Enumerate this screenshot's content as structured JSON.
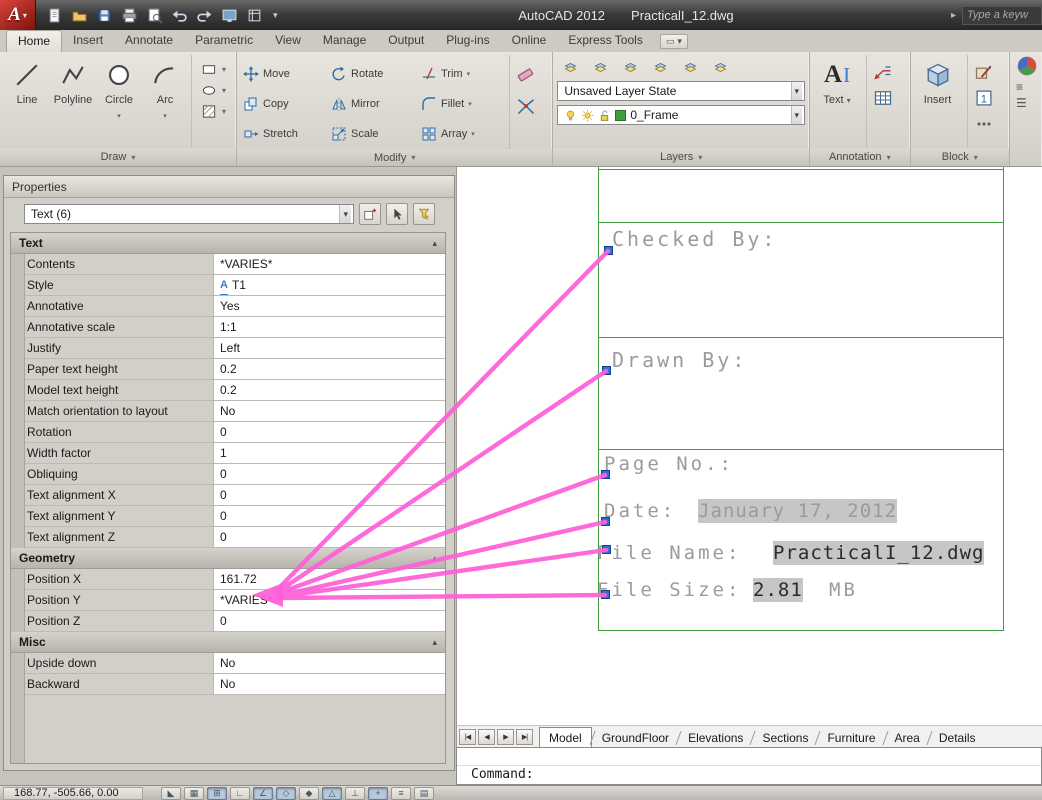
{
  "titlebar": {
    "app_title": "AutoCAD 2012",
    "doc_title": "PracticalI_12.dwg",
    "search_placeholder": "Type a keyw",
    "qat_icons": [
      "new-icon",
      "open-icon",
      "save-icon",
      "plot-icon",
      "preview-icon",
      "undo-icon",
      "redo-icon",
      "screen-icon",
      "sheet-icon"
    ]
  },
  "ribbon": {
    "tabs": [
      {
        "label": "Home",
        "active": true
      },
      {
        "label": "Insert"
      },
      {
        "label": "Annotate"
      },
      {
        "label": "Parametric"
      },
      {
        "label": "View"
      },
      {
        "label": "Manage"
      },
      {
        "label": "Output"
      },
      {
        "label": "Plug-ins"
      },
      {
        "label": "Online"
      },
      {
        "label": "Express Tools"
      }
    ],
    "panels": {
      "draw": {
        "label": "Draw",
        "tools": [
          {
            "name": "line",
            "label": "Line"
          },
          {
            "name": "polyline",
            "label": "Polyline"
          },
          {
            "name": "circle",
            "label": "Circle",
            "flyout": true
          },
          {
            "name": "arc",
            "label": "Arc",
            "flyout": true
          }
        ]
      },
      "modify": {
        "label": "Modify",
        "tools": [
          {
            "name": "move",
            "label": "Move"
          },
          {
            "name": "rotate",
            "label": "Rotate"
          },
          {
            "name": "trim",
            "label": "Trim",
            "flyout": true
          },
          {
            "name": "copy",
            "label": "Copy"
          },
          {
            "name": "mirror",
            "label": "Mirror"
          },
          {
            "name": "fillet",
            "label": "Fillet",
            "flyout": true
          },
          {
            "name": "stretch",
            "label": "Stretch"
          },
          {
            "name": "scale",
            "label": "Scale"
          },
          {
            "name": "array",
            "label": "Array",
            "flyout": true
          }
        ]
      },
      "layers": {
        "label": "Layers",
        "layer_state": "Unsaved Layer State",
        "current_layer": "0_Frame",
        "tool_icons": [
          "layer-properties-icon",
          "layer-off-icon",
          "layer-isolate-icon",
          "layer-freeze-icon",
          "layer-lock-icon",
          "layer-match-icon"
        ]
      },
      "annotation": {
        "label": "Annotation",
        "text_tool": "Text"
      },
      "block": {
        "label": "Block",
        "insert_tool": "Insert"
      }
    }
  },
  "properties_palette": {
    "title": "Properties",
    "selection": "Text (6)",
    "sections": [
      {
        "name": "Text",
        "rows": [
          {
            "label": "Contents",
            "value": "*VARIES*"
          },
          {
            "label": "Style",
            "value": "T1",
            "icon": "annotative-icon"
          },
          {
            "label": "Annotative",
            "value": "Yes"
          },
          {
            "label": "Annotative scale",
            "value": "1:1"
          },
          {
            "label": "Justify",
            "value": "Left"
          },
          {
            "label": "Paper text height",
            "value": "0.2"
          },
          {
            "label": "Model text height",
            "value": "0.2"
          },
          {
            "label": "Match orientation to layout",
            "value": "No"
          },
          {
            "label": "Rotation",
            "value": "0"
          },
          {
            "label": "Width factor",
            "value": "1"
          },
          {
            "label": "Obliquing",
            "value": "0"
          },
          {
            "label": "Text alignment X",
            "value": "0"
          },
          {
            "label": "Text alignment Y",
            "value": "0"
          },
          {
            "label": "Text alignment Z",
            "value": "0"
          }
        ]
      },
      {
        "name": "Geometry",
        "rows": [
          {
            "label": "Position X",
            "value": "161.72"
          },
          {
            "label": "Position Y",
            "value": "*VARIES*"
          },
          {
            "label": "Position Z",
            "value": "0"
          }
        ]
      },
      {
        "name": "Misc",
        "rows": [
          {
            "label": "Upside down",
            "value": "No"
          },
          {
            "label": "Backward",
            "value": "No"
          }
        ]
      }
    ]
  },
  "drawing": {
    "checked_by": "Checked By:",
    "drawn_by": "Drawn By:",
    "page_no": "Page No.:",
    "date_label": "Date:",
    "date_value": "January 17, 2012",
    "file_name_label": "File Name:",
    "file_name_value": "PracticalI_12.dwg",
    "file_size_label": "File Size:",
    "file_size_value": "2.81",
    "file_size_unit": "MB"
  },
  "layout_tabs": [
    {
      "label": "Model",
      "active": true
    },
    {
      "label": "GroundFloor"
    },
    {
      "label": "Elevations"
    },
    {
      "label": "Sections"
    },
    {
      "label": "Furniture"
    },
    {
      "label": "Area"
    },
    {
      "label": "Details"
    }
  ],
  "command_line": {
    "prompt": "Command:"
  },
  "statusbar": {
    "coordinates": "168.77, -505.66, 0.00",
    "toggles": [
      {
        "name": "infer-constraints-toggle",
        "glyph": "◣",
        "pressed": false
      },
      {
        "name": "snap-mode-toggle",
        "glyph": "▦",
        "pressed": false
      },
      {
        "name": "grid-display-toggle",
        "glyph": "⊞",
        "pressed": true
      },
      {
        "name": "ortho-mode-toggle",
        "glyph": "∟",
        "pressed": false
      },
      {
        "name": "polar-tracking-toggle",
        "glyph": "∠",
        "pressed": true
      },
      {
        "name": "object-snap-toggle",
        "glyph": "◇",
        "pressed": true
      },
      {
        "name": "3d-object-snap-toggle",
        "glyph": "◆",
        "pressed": false
      },
      {
        "name": "object-snap-tracking-toggle",
        "glyph": "△",
        "pressed": true
      },
      {
        "name": "dynamic-ucs-toggle",
        "glyph": "⊥",
        "pressed": false
      },
      {
        "name": "dynamic-input-toggle",
        "glyph": "+",
        "pressed": true
      },
      {
        "name": "lineweight-toggle",
        "glyph": "≡",
        "pressed": false
      },
      {
        "name": "quick-properties-toggle",
        "glyph": "▤",
        "pressed": false
      }
    ]
  },
  "colors": {
    "frame_green": "#3f9e3f",
    "arrow_magenta": "#ff5fd8",
    "grip_blue": "#2f6fd6",
    "highlight_gray": "#c6c6c6"
  }
}
